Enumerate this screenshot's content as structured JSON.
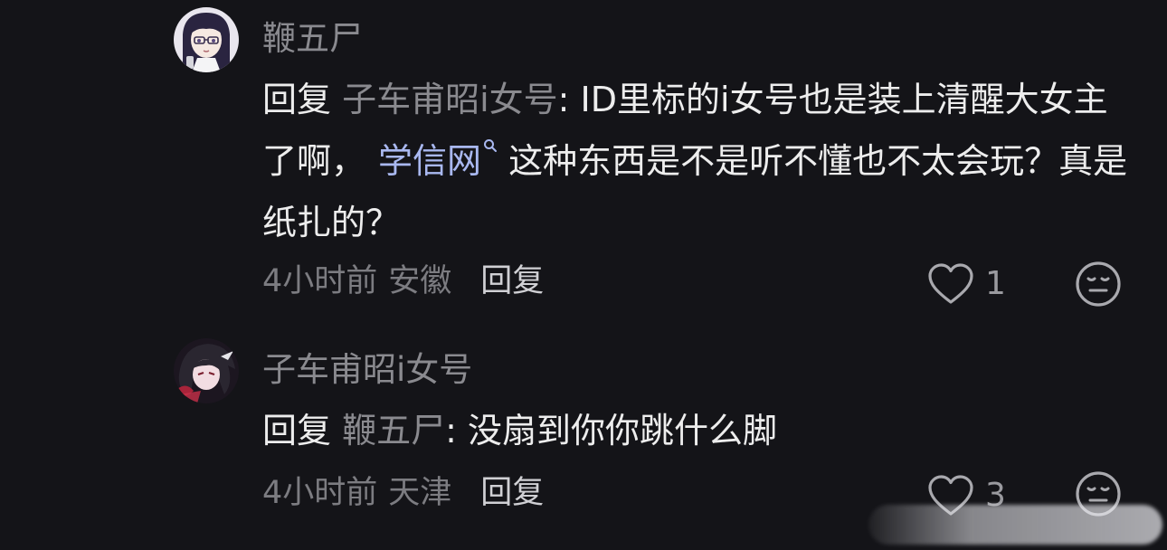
{
  "comments": [
    {
      "username": "鞭五尸",
      "reply_word": "回复",
      "reply_target": "子车甫昭i女号",
      "text_part1": ": ID里标的i女号也是装上清醒大女主了啊，",
      "link_text": "学信网",
      "text_part2": " 这种东西是不是听不懂也不太会玩？真是纸扎的？",
      "time": "4小时前",
      "location": "安徽",
      "reply_button": "回复",
      "likes": "1"
    },
    {
      "username": "子车甫昭i女号",
      "reply_word": "回复",
      "reply_target": "鞭五尸",
      "text_part1": ": 没扇到你你跳什么脚",
      "time": "4小时前",
      "location": "天津",
      "reply_button": "回复",
      "likes": "3"
    }
  ],
  "icons": {
    "like": "heart-outline-icon",
    "emoji": "neutral-face-icon",
    "search": "search-icon"
  },
  "colors": {
    "background": "#141418",
    "link": "#a9b8f0",
    "muted": "#8a8a8f"
  }
}
